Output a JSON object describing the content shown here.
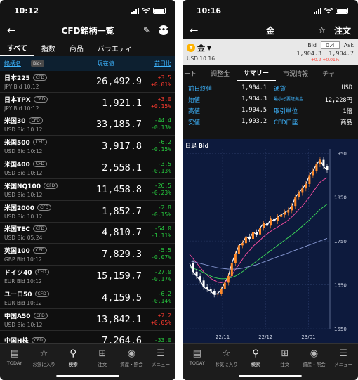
{
  "left": {
    "status": {
      "time": "10:12"
    },
    "title": "CFD銘柄一覧",
    "tabs": [
      "すべて",
      "指数",
      "商品",
      "バラエティ"
    ],
    "header": {
      "name": "銘柄名",
      "bid_pill": "Bid▾",
      "price": "現在値",
      "change": "前日比"
    },
    "cfd_tag": "CFD",
    "rows": [
      {
        "name": "日本225",
        "sub": "JPY Bid 10:12",
        "price": "26,492.9",
        "chg": "+3.5",
        "pct": "+0.01%",
        "dir": "up"
      },
      {
        "name": "日本TPX",
        "sub": "JPY Bid 10:12",
        "price": "1,921.1",
        "chg": "+3.0",
        "pct": "+0.15%",
        "dir": "up"
      },
      {
        "name": "米国30",
        "sub": "USD Bid 10:12",
        "price": "33,185.7",
        "chg": "-44.4",
        "pct": "-0.13%",
        "dir": "down"
      },
      {
        "name": "米国500",
        "sub": "USD Bid 10:12",
        "price": "3,917.8",
        "chg": "-6.2",
        "pct": "-0.15%",
        "dir": "down"
      },
      {
        "name": "米国400",
        "sub": "USD Bid 10:12",
        "price": "2,558.1",
        "chg": "-3.5",
        "pct": "-0.13%",
        "dir": "down"
      },
      {
        "name": "米国NQ100",
        "sub": "USD Bid 10:12",
        "price": "11,458.8",
        "chg": "-26.5",
        "pct": "-0.23%",
        "dir": "down"
      },
      {
        "name": "米国2000",
        "sub": "USD Bid 10:12",
        "price": "1,852.7",
        "chg": "-2.8",
        "pct": "-0.15%",
        "dir": "down"
      },
      {
        "name": "米国TEC",
        "sub": "USD Bid 05:24",
        "price": "4,810.7",
        "chg": "-54.0",
        "pct": "-1.11%",
        "dir": "down"
      },
      {
        "name": "英国100",
        "sub": "GBP Bid 10:12",
        "price": "7,829.3",
        "chg": "-5.5",
        "pct": "-0.07%",
        "dir": "down"
      },
      {
        "name": "ドイツ40",
        "sub": "EUR Bid 10:12",
        "price": "15,159.7",
        "chg": "-27.0",
        "pct": "-0.17%",
        "dir": "down"
      },
      {
        "name": "ユーロ50",
        "sub": "EUR Bid 10:12",
        "price": "4,159.5",
        "chg": "-6.2",
        "pct": "-0.14%",
        "dir": "down"
      },
      {
        "name": "中国A50",
        "sub": "USD Bid 10:12",
        "price": "13,842.1",
        "chg": "+7.2",
        "pct": "+0.05%",
        "dir": "up"
      },
      {
        "name": "中国H株",
        "sub": "",
        "price": "7,264.6",
        "chg": "-33.0",
        "pct": "",
        "dir": "down"
      }
    ],
    "nav": [
      {
        "label": "TODAY",
        "icon": "▤"
      },
      {
        "label": "お気に入り",
        "icon": "☆"
      },
      {
        "label": "検索",
        "icon": "⚲"
      },
      {
        "label": "注文",
        "icon": "⊞"
      },
      {
        "label": "資産・照会",
        "icon": "◉"
      },
      {
        "label": "メニュー",
        "icon": "☰"
      }
    ]
  },
  "right": {
    "status": {
      "time": "10:16"
    },
    "title": "金",
    "order_label": "注文",
    "quote": {
      "symbol": "金",
      "symbol_icon_text": "¥",
      "time": "USD 10:16",
      "bid_label": "Bid",
      "spread": "0.4",
      "ask_label": "Ask",
      "bid": "1,904.3",
      "ask": "1,904.7",
      "chg": "+0.2",
      "pct": "+0.01%"
    },
    "subtabs": [
      "ート",
      "調整金",
      "サマリー",
      "市況情報",
      "チャ"
    ],
    "summary_left": [
      {
        "label": "前日終値",
        "value": "1,904.1"
      },
      {
        "label": "始値",
        "value": "1,904.3"
      },
      {
        "label": "高値",
        "value": "1,904.5"
      },
      {
        "label": "安値",
        "value": "1,903.2"
      }
    ],
    "summary_right": [
      {
        "label": "通貨",
        "value": "USD"
      },
      {
        "label": "最小必要証拠金",
        "value": "12,228円"
      },
      {
        "label": "取引単位",
        "value": "1倍"
      },
      {
        "label": "CFD口座",
        "value": "商品"
      }
    ],
    "chart_title": "日足 Bid",
    "nav": [
      {
        "label": "TODAY",
        "icon": "▤"
      },
      {
        "label": "お気に入り",
        "icon": "☆"
      },
      {
        "label": "検索",
        "icon": "⚲"
      },
      {
        "label": "注文",
        "icon": "⊞"
      },
      {
        "label": "資産・照会",
        "icon": "◉"
      },
      {
        "label": "メニュー",
        "icon": "☰"
      }
    ]
  },
  "chart_data": {
    "type": "line",
    "title": "日足 Bid",
    "x_ticks": [
      "22/11",
      "22/12",
      "23/01"
    ],
    "y_ticks": [
      1550,
      1650,
      1750,
      1850,
      1950
    ],
    "ylim": [
      1550,
      1960
    ],
    "grid": true,
    "series": [
      {
        "values": [
          1700,
          1680,
          1670,
          1660,
          1645,
          1640,
          1635,
          1628,
          1630,
          1640,
          1655,
          1670,
          1700,
          1720,
          1740,
          1745,
          1760,
          1755,
          1770,
          1765,
          1780,
          1790,
          1785,
          1800,
          1795,
          1805,
          1810,
          1815,
          1820,
          1830,
          1850,
          1860,
          1870,
          1880,
          1900,
          1910,
          1925,
          1935,
          1920,
          1912
        ]
      },
      {
        "values": [
          1720,
          1710,
          1700,
          1690,
          1680,
          1672,
          1665,
          1660,
          1656,
          1655,
          1657,
          1662,
          1672,
          1685,
          1697,
          1708,
          1720,
          1728,
          1738,
          1745,
          1752,
          1760,
          1766,
          1772,
          1777,
          1782,
          1787,
          1792,
          1798,
          1805,
          1813,
          1822,
          1830,
          1840,
          1851,
          1862,
          1873,
          1884,
          1890,
          1894
        ]
      },
      {
        "values": [
          1690,
          1688,
          1685,
          1682,
          1678,
          1674,
          1670,
          1667,
          1665,
          1664,
          1664,
          1665,
          1667,
          1670,
          1675,
          1680,
          1686,
          1692,
          1698,
          1704,
          1710,
          1716,
          1722,
          1728,
          1734,
          1740,
          1746,
          1752,
          1758,
          1764,
          1770,
          1777,
          1784,
          1791,
          1798,
          1806,
          1814,
          1822,
          1828,
          1834
        ]
      },
      {
        "values": [
          1705,
          1703,
          1701,
          1699,
          1697,
          1695,
          1693,
          1691,
          1689,
          1688,
          1687,
          1686,
          1686,
          1686,
          1687,
          1688,
          1690,
          1692,
          1694,
          1696,
          1699,
          1702,
          1705,
          1708,
          1711,
          1714,
          1717,
          1720,
          1723,
          1726,
          1729,
          1732,
          1735,
          1738,
          1741,
          1744,
          1747,
          1750,
          1753,
          1756
        ]
      }
    ]
  }
}
